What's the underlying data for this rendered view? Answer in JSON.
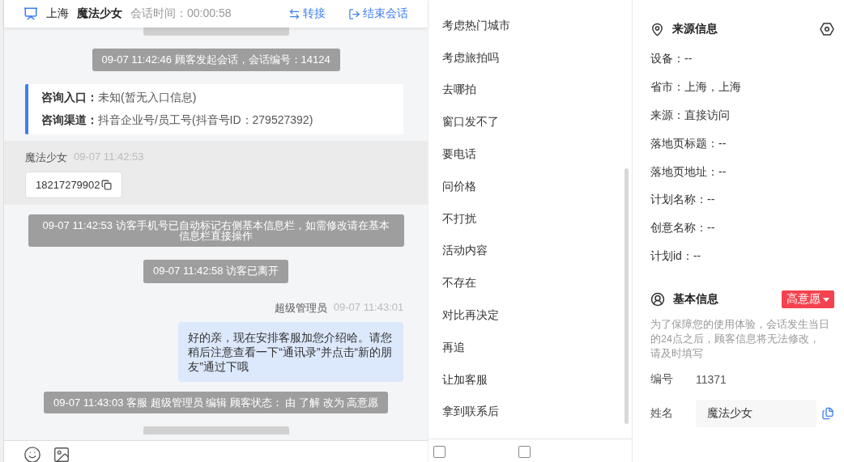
{
  "header": {
    "location": "上海",
    "name": "魔法少女",
    "timer": "会话时间：00:00:58",
    "actions": [
      {
        "label": "转接",
        "kind": "transfer"
      },
      {
        "label": "结束会话",
        "kind": "end"
      }
    ]
  },
  "messages": [
    {
      "kind": "system",
      "text": "09-07 11:42:46 顾客发起会话，会话编号：14124"
    },
    {
      "kind": "info",
      "lines": [
        {
          "label": "咨询入口：",
          "value": "未知(暂无入口信息)"
        },
        {
          "label": "咨询渠道：",
          "value": "抖音企业号/员工号(抖音号ID：279527392)"
        }
      ]
    },
    {
      "kind": "visitor",
      "sender": "魔法少女",
      "time": "09-07 11:42:53",
      "text": "18217279902"
    },
    {
      "kind": "system",
      "text": "09-07 11:42:53 访客手机号已自动标记右侧基本信息栏，如需修改请在基本信息栏直接操作"
    },
    {
      "kind": "system",
      "text": "09-07 11:42:58 访客已离开"
    },
    {
      "kind": "agent",
      "sender": "超级管理员",
      "time": "09-07 11:43:01",
      "text": "好的亲，现在安排客服加您介绍哈。请您稍后注意查看一下“通讯录”并点击“新的朋友”通过下哦"
    },
    {
      "kind": "system",
      "text": "09-07 11:43:03 客服 超级管理员 编辑 顾客状态： 由 了解 改为 高意愿"
    }
  ],
  "footer_checks": [
    {
      "checked": false
    },
    {
      "checked": false
    }
  ],
  "phrases": [
    "考虑热门城市",
    "考虑旅拍吗",
    "去哪拍",
    "窗口发不了",
    "要电话",
    "问价格",
    "不打扰",
    "活动内容",
    "不存在",
    "对比再决定",
    "再追",
    "让加客服",
    "拿到联系后"
  ],
  "source_info": {
    "title": "来源信息",
    "fields": [
      "设备：--",
      "省市：上海，上海",
      "来源：直接访问",
      "落地页标题：--",
      "落地页地址：--",
      "计划名称：--",
      "创意名称：--",
      "计划id：--"
    ]
  },
  "basic_info": {
    "title": "基本信息",
    "intent_tag": "高意愿",
    "notice": "为了保障您的使用体验，会话发生当日的24点之后，顾客信息将无法修改，请及时填写",
    "fields": [
      {
        "kind": "text",
        "label": "编号",
        "value": "11371"
      },
      {
        "kind": "input",
        "label": "姓名",
        "value": "魔法少女"
      }
    ]
  }
}
